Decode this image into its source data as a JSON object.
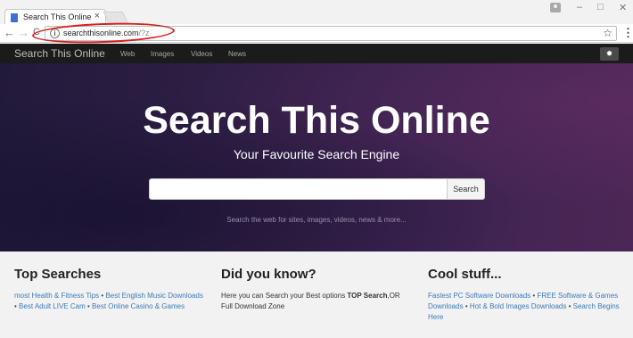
{
  "browser": {
    "tab_title": "Search This Online",
    "tab_close": "×",
    "url_domain": "searchthisonline.com",
    "url_path": "/?z",
    "window_controls": {
      "minimize": "–",
      "maximize": "□",
      "close": "✕"
    },
    "nav_icons": {
      "back": "←",
      "forward": "→",
      "reload": "C"
    },
    "info_glyph": "i",
    "star_glyph": "☆",
    "menu_glyph": "⋮"
  },
  "site_nav": {
    "brand": "Search This Online",
    "links": [
      "Web",
      "Images",
      "Videos",
      "News"
    ],
    "settings_glyph": "✹"
  },
  "hero": {
    "title": "Search This Online",
    "subtitle": "Your Favourite Search Engine",
    "search_placeholder": "",
    "search_button": "Search",
    "hint": "Search the web for sites, images, videos, news & more..."
  },
  "sections": {
    "top_searches": {
      "title": "Top Searches",
      "links": [
        "most Health & Fitness Tips",
        "Best English Music Downloads",
        "Best Adult LIVE Cam",
        "Best Online Casino & Games"
      ],
      "separator": "•"
    },
    "did_you_know": {
      "title": "Did you know?",
      "text_before": "Here you can Search your Best options ",
      "text_bold": "TOP Search",
      "text_after": ",OR Full Download Zone"
    },
    "cool_stuff": {
      "title": "Cool stuff...",
      "links": [
        "Fastest PC Software Downloads",
        "FREE Software & Games Downloads",
        "Hot & Bold Images Downloads",
        "Search Begins Here"
      ],
      "separator": "•"
    }
  },
  "colors": {
    "annotation_circle": "#d41f1f",
    "link": "#3a7ab8",
    "hero_gradient_start": "#221a3b",
    "hero_gradient_end": "#4c2756"
  }
}
